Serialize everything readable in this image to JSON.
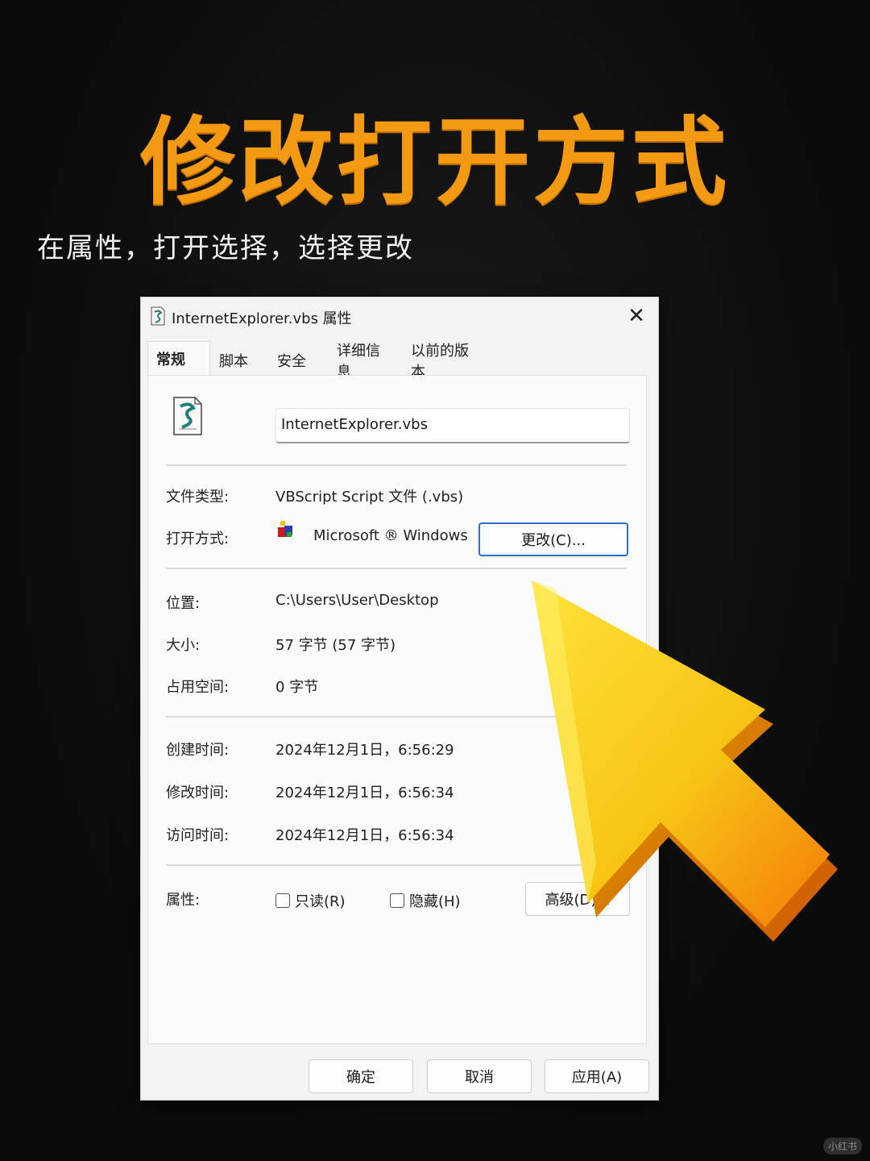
{
  "poster": {
    "headline": "修改打开方式",
    "subtitle": "在属性，打开选择，选择更改",
    "watermark": "小红书"
  },
  "dialog": {
    "title": "InternetExplorer.vbs 属性",
    "close_glyph": "✕",
    "tabs": [
      {
        "label": "常规",
        "active": true
      },
      {
        "label": "脚本",
        "active": false
      },
      {
        "label": "安全",
        "active": false
      },
      {
        "label": "详细信息",
        "active": false
      },
      {
        "label": "以前的版本",
        "active": false
      }
    ],
    "file_name": "InternetExplorer.vbs",
    "rows": {
      "file_type_label": "文件类型:",
      "file_type_value": "VBScript Script 文件 (.vbs)",
      "open_with_label": "打开方式:",
      "open_with_value": "Microsoft ® Windows",
      "change_button": "更改(C)...",
      "location_label": "位置:",
      "location_value": "C:\\Users\\User\\Desktop",
      "size_label": "大小:",
      "size_value": "57 字节 (57 字节)",
      "disk_label": "占用空间:",
      "disk_value": "0 字节",
      "created_label": "创建时间:",
      "created_value": "2024年12月1日，6:56:29",
      "modified_label": "修改时间:",
      "modified_value": "2024年12月1日，6:56:34",
      "accessed_label": "访问时间:",
      "accessed_value": "2024年12月1日，6:56:34",
      "attributes_label": "属性:",
      "readonly_label": "只读(R)",
      "hidden_label": "隐藏(H)",
      "advanced_button": "高级(D)..."
    },
    "footer": {
      "ok": "确定",
      "cancel": "取消",
      "apply": "应用(A)"
    }
  },
  "icons": {
    "title": "script-file-icon",
    "file": "script-file-icon",
    "app": "windows-script-host-icon",
    "pointer": "cursor-arrow-icon"
  },
  "colors": {
    "headline": "#f39a12",
    "arrow_yellow": "#f7d21a",
    "arrow_orange": "#f58a0c",
    "primary_border": "#2f6fd0"
  }
}
